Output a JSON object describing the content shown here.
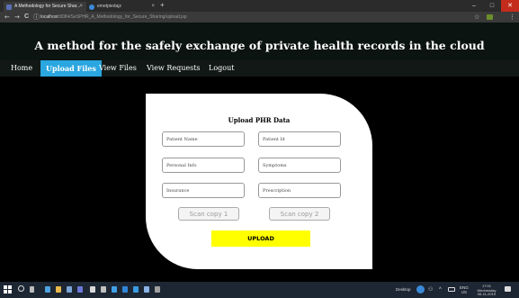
{
  "browser": {
    "tabs": [
      {
        "title": "A Methodology for Secure Shar...",
        "close": "×"
      },
      {
        "title": "emetpiedajz",
        "close": "×"
      }
    ],
    "new_tab": "+",
    "window_controls": {
      "minimize": "–",
      "maximize": "□",
      "close": "✕"
    },
    "url_host": "localhost",
    "url_path": ":8084/SeSPHR_A_Methodology_for_Secure_Sharing/upload.jsp",
    "nav_icons": {
      "back": "←",
      "forward": "→",
      "reload": "C",
      "info": "ⓘ",
      "star": "☆",
      "menu": "⋮"
    }
  },
  "app": {
    "title": "A method for the safely exchange of private health records in the cloud",
    "nav": [
      {
        "label": "Home"
      },
      {
        "label": "Upload Files"
      },
      {
        "label": "View Files"
      },
      {
        "label": "View Requests"
      },
      {
        "label": "Logout"
      }
    ]
  },
  "form": {
    "heading": "Upload PHR Data",
    "fields": {
      "patient_name": {
        "placeholder": "Patient Name",
        "value": ""
      },
      "patient_id": {
        "placeholder": "Patient Id",
        "value": ""
      },
      "personal_info": {
        "placeholder": "Personal Info",
        "value": ""
      },
      "symptoms": {
        "placeholder": "Symptoms",
        "value": ""
      },
      "insurance": {
        "placeholder": "Insurance",
        "value": ""
      },
      "prescription": {
        "placeholder": "Prescription",
        "value": ""
      }
    },
    "scan1_label": "Scan copy 1",
    "scan2_label": "Scan copy 2",
    "upload_label": "UPLOAD"
  },
  "taskbar": {
    "desktop_label": "Desktop",
    "lang_top": "ENG",
    "lang_bottom": "US",
    "time": "17:01",
    "day": "Wednesday",
    "date": "06-11-2019"
  },
  "colors": {
    "nav_active": "#2aa6e0",
    "upload_button": "#ffff00",
    "page_background": "#000000",
    "card_background": "#ffffff"
  }
}
